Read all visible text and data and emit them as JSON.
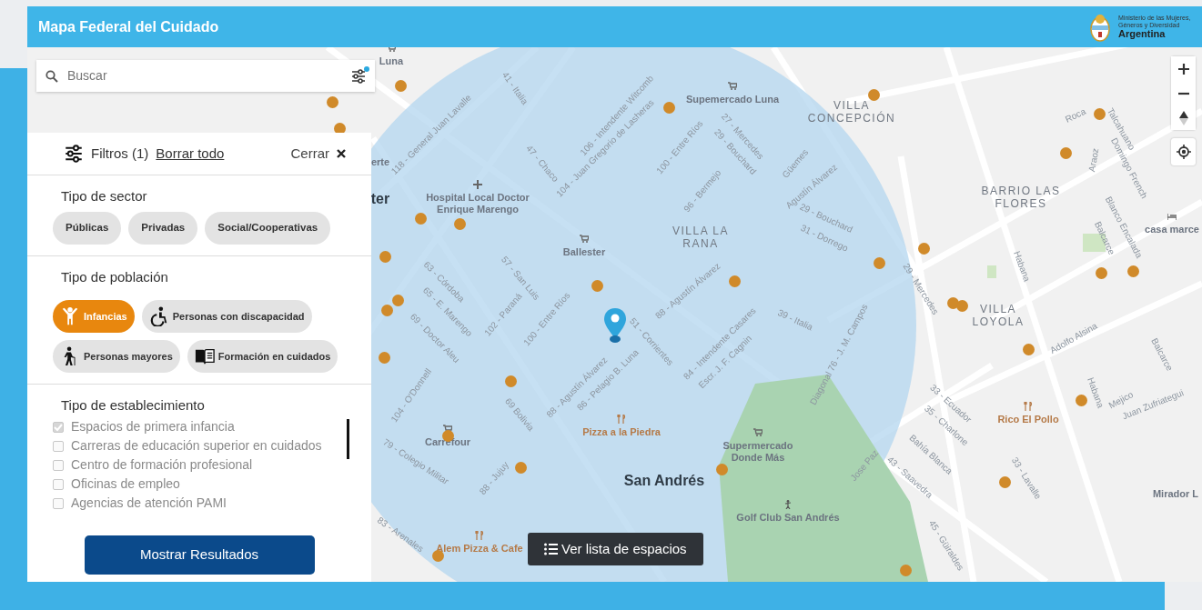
{
  "header": {
    "title": "Mapa Federal del Cuidado",
    "ministry": "Ministerio de las Mujeres, Géneros y Diversidad",
    "country": "Argentina"
  },
  "search": {
    "placeholder": "Buscar",
    "filters_active": true
  },
  "filters": {
    "title": "Filtros (1)",
    "clear": "Borrar todo",
    "close": "Cerrar",
    "sector": {
      "heading": "Tipo de sector",
      "options": [
        {
          "label": "Públicas",
          "selected": false
        },
        {
          "label": "Privadas",
          "selected": false
        },
        {
          "label": "Social/Cooperativas",
          "selected": false
        }
      ]
    },
    "population": {
      "heading": "Tipo de población",
      "options": [
        {
          "label": "Infancias",
          "kind": "child",
          "selected": true
        },
        {
          "label": "Personas con discapacidad",
          "kind": "wheelchair",
          "selected": false
        },
        {
          "label": "Personas mayores",
          "kind": "elder",
          "selected": false
        },
        {
          "label": "Formación en cuidados",
          "kind": "book",
          "selected": false
        }
      ]
    },
    "establishment": {
      "heading": "Tipo de establecimiento",
      "options": [
        {
          "label": "Espacios de primera infancia",
          "checked": true
        },
        {
          "label": "Carreras de educación superior en cuidados",
          "checked": false
        },
        {
          "label": "Centro de formación profesional",
          "checked": false
        },
        {
          "label": "Oficinas de empleo",
          "checked": false
        },
        {
          "label": "Agencias de atención PAMI",
          "checked": false
        }
      ]
    },
    "submit": "Mostrar Resultados"
  },
  "map": {
    "list_button": "Ver lista de espacios",
    "labels": [
      {
        "text": "Luna",
        "kind": "shop"
      },
      {
        "text": "Supemercado Luna",
        "kind": "shop"
      },
      {
        "text": "VILLA CONCEPCIÓN",
        "kind": "place"
      },
      {
        "text": "BARRIO LAS FLORES",
        "kind": "place"
      },
      {
        "text": "casa marce",
        "kind": "hotel"
      },
      {
        "text": "erte",
        "kind": "poi"
      },
      {
        "text": "ter",
        "kind": "district"
      },
      {
        "text": "Hospital Local Doctor Enrique Marengo",
        "kind": "hospital"
      },
      {
        "text": "Ballester",
        "kind": "shop"
      },
      {
        "text": "VILLA LA RANA",
        "kind": "place"
      },
      {
        "text": "VILLA LOYOLA",
        "kind": "place"
      },
      {
        "text": "Rico El Pollo",
        "kind": "food"
      },
      {
        "text": "Pizza a la Piedra",
        "kind": "food"
      },
      {
        "text": "Carrefour",
        "kind": "shop"
      },
      {
        "text": "Supermercado Donde Más",
        "kind": "shop"
      },
      {
        "text": "San Andrés",
        "kind": "district"
      },
      {
        "text": "Golf Club San Andrés",
        "kind": "golf"
      },
      {
        "text": "Alem Pizza & Cafe",
        "kind": "food"
      },
      {
        "text": "Mirador L",
        "kind": "poi"
      },
      {
        "text": "41 - Italia",
        "kind": "street"
      },
      {
        "text": "118 - General Juan Lavalle",
        "kind": "street"
      },
      {
        "text": "106 - Intendente Witcomb",
        "kind": "street"
      },
      {
        "text": "104 - Juan Gregorio de Lasheras",
        "kind": "street"
      },
      {
        "text": "27 - Mercedes",
        "kind": "street"
      },
      {
        "text": "29 - Bouchard",
        "kind": "street"
      },
      {
        "text": "100 - Entre Ríos",
        "kind": "street"
      },
      {
        "text": "96 - Bermejo",
        "kind": "street"
      },
      {
        "text": "47 - Chaco",
        "kind": "street"
      },
      {
        "text": "Güemes",
        "kind": "street"
      },
      {
        "text": "Agustín Álvarez",
        "kind": "street"
      },
      {
        "text": "29 - Bouchard",
        "kind": "street"
      },
      {
        "text": "31 - Dorrego",
        "kind": "street"
      },
      {
        "text": "63 - Córdoba",
        "kind": "street"
      },
      {
        "text": "57 - San Luis",
        "kind": "street"
      },
      {
        "text": "65 - E. Marengo",
        "kind": "street"
      },
      {
        "text": "102 - Paraná",
        "kind": "street"
      },
      {
        "text": "100 - Entre Ríos",
        "kind": "street"
      },
      {
        "text": "88 - Agustín Álvarez",
        "kind": "street"
      },
      {
        "text": "69 - Doctor Aleu",
        "kind": "street"
      },
      {
        "text": "104 - O'Donnell",
        "kind": "street"
      },
      {
        "text": "51 - Corrientes",
        "kind": "street"
      },
      {
        "text": "84 - Intendente Casares",
        "kind": "street"
      },
      {
        "text": "Escr. J. F. Cagnin",
        "kind": "street"
      },
      {
        "text": "88 - Agustín Álvarez",
        "kind": "street"
      },
      {
        "text": "86 - Pelagio B. Luna",
        "kind": "street"
      },
      {
        "text": "69 Bolivia",
        "kind": "street"
      },
      {
        "text": "79 - Colegio Militar",
        "kind": "street"
      },
      {
        "text": "88 - Jujuy",
        "kind": "street"
      },
      {
        "text": "83 - Arenales",
        "kind": "street"
      },
      {
        "text": "39 - Italia",
        "kind": "street"
      },
      {
        "text": "Diagonal 76 - J. M. Campos",
        "kind": "street"
      },
      {
        "text": "29 - Mercedes",
        "kind": "street"
      },
      {
        "text": "Roca",
        "kind": "street"
      },
      {
        "text": "Talcahuano",
        "kind": "street"
      },
      {
        "text": "Domingo French",
        "kind": "street"
      },
      {
        "text": "Araoz",
        "kind": "street"
      },
      {
        "text": "Blanco Encalada",
        "kind": "street"
      },
      {
        "text": "Balcarce",
        "kind": "street"
      },
      {
        "text": "Habana",
        "kind": "street"
      },
      {
        "text": "Adolfo Alsina",
        "kind": "street"
      },
      {
        "text": "Balcarce",
        "kind": "street"
      },
      {
        "text": "Habana",
        "kind": "street"
      },
      {
        "text": "Mejico",
        "kind": "street"
      },
      {
        "text": "Juan Zufriategui",
        "kind": "street"
      },
      {
        "text": "33 - Ecuador",
        "kind": "street"
      },
      {
        "text": "35 - Charlone",
        "kind": "street"
      },
      {
        "text": "Bahía Blanca",
        "kind": "street"
      },
      {
        "text": "43 - Saavedra",
        "kind": "street"
      },
      {
        "text": "Jose Paz",
        "kind": "street"
      },
      {
        "text": "33 - Lavalle",
        "kind": "street"
      },
      {
        "text": "45 - Güiraldes",
        "kind": "street"
      }
    ]
  }
}
